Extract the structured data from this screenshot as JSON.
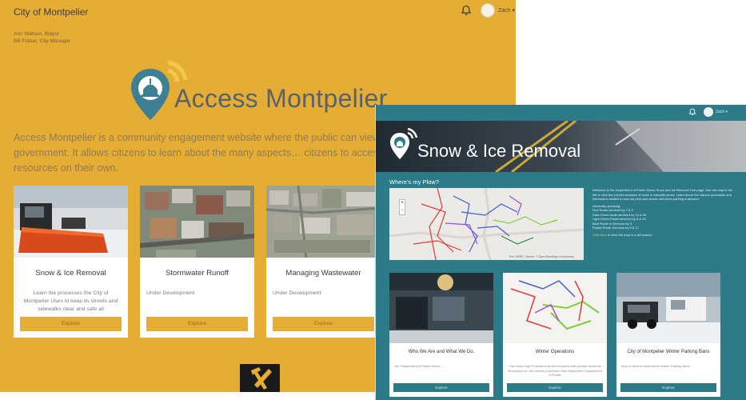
{
  "left_window": {
    "title": "City of Montpelier",
    "user_label": "Zach ▾",
    "officials": [
      "Ann Watson, Mayor",
      "Bill Fraser, City Manager"
    ],
    "brand": "Access Montpelier",
    "intro": "Access Montpelier is a community engagement website where the public can view lea… to the operations of city government. It allows citizens to learn about the many aspects… citizens to access and use the city's information resources on their own.",
    "accent_color": "#e6ad34",
    "cards": [
      {
        "title": "Snow & Ice Removal",
        "description": "Learn the processes the City of Montpelier Uses to keep its streets and sidewalks clear and safe all",
        "button": "Explore"
      },
      {
        "title": "Stormwater Runoff",
        "description": "Under Development",
        "button": "Explore"
      },
      {
        "title": "Managing Wastewater",
        "description": "Under Development",
        "button": "Explore"
      }
    ]
  },
  "right_window": {
    "user_label": "Zach ▾",
    "hero_title": "Snow & Ice Removal",
    "map_heading": "Where's my Plow?",
    "map_attribution": "Esri, HERE, Garmin, © OpenStreetMap contributors",
    "zoom_in": "+",
    "zoom_out": "−",
    "accent_color": "#2d7a89",
    "side_text": [
      "Welcome to the Department of Public Works Snow and Ice Removal Hub page. Use the map to the left to view the current locations of snow & sidewalk plows. Learn about the various processes and information related to how we plow and where and when parking is allowed.",
      "Generally speaking:",
      "Red Route serviced by 7 & 2",
      "Dark Green route serviced by 14 & 25",
      "Light Green Route serviced by 8 & 26",
      "Blue Route is Serviced by 9",
      "Purple Route Serviced by 5 & 17"
    ],
    "side_link": "Click here",
    "side_link_rest": " to view the map in a full screen.",
    "cards": [
      {
        "title": "Who We Are and What We Do.",
        "description": "Our Department of Public Works ...",
        "button": "Explore"
      },
      {
        "title": "Winter Operations",
        "description": "This Story Map Provides a series of panels that provide residents information on the various processes that Montpelier's Department of Public",
        "button": "Explore"
      },
      {
        "title": "City of Montpelier Winter Parking Bans",
        "description": "All you need to know about Winter Parking Bans.",
        "button": "Explore"
      }
    ]
  }
}
